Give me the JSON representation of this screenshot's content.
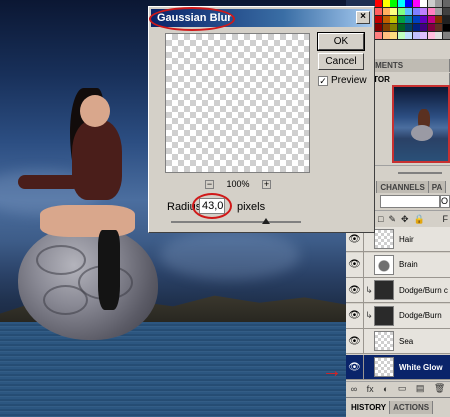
{
  "dialog": {
    "title": "Gaussian Blur",
    "ok_label": "OK",
    "cancel_label": "Cancel",
    "preview_label": "Preview",
    "preview_checked": "✓",
    "zoom_value": "100%",
    "zoom_out": "−",
    "zoom_in": "+",
    "radius_label": "Radius:",
    "radius_value": "43,0",
    "unit_label": "pixels",
    "close_glyph": "×",
    "slider_position_fraction": 0.73
  },
  "panels": {
    "top_tabs": [
      "ITMENTS"
    ],
    "navigator_tab": "ATOR",
    "layers_tabs": [
      "S",
      "CHANNELS",
      "PA"
    ],
    "opacity_label": "O",
    "lock_icons": [
      "□",
      "✎",
      "✥",
      "🔒"
    ],
    "fill_label": "F",
    "layers": [
      {
        "name": "Hair",
        "thumb": "transparent",
        "linked": ""
      },
      {
        "name": "Brain",
        "thumb": "brain",
        "linked": ""
      },
      {
        "name": "Dodge/Burn c",
        "thumb": "dark",
        "linked": "↳"
      },
      {
        "name": "Dodge/Burn",
        "thumb": "dark",
        "linked": "↳"
      },
      {
        "name": "Sea",
        "thumb": "transparent",
        "linked": ""
      },
      {
        "name": "White Glow",
        "thumb": "transparent",
        "linked": "",
        "selected": true
      }
    ],
    "footer_icons": [
      "∞",
      "fx",
      "◐",
      "▭",
      "▤",
      "🗑"
    ],
    "bottom_tabs": [
      "HISTORY",
      "ACTIONS"
    ]
  },
  "colors": {
    "title_bar": "#0a246a",
    "annotation": "#d01818",
    "selected_layer": "#0a246a"
  },
  "arrow_glyph": "→"
}
